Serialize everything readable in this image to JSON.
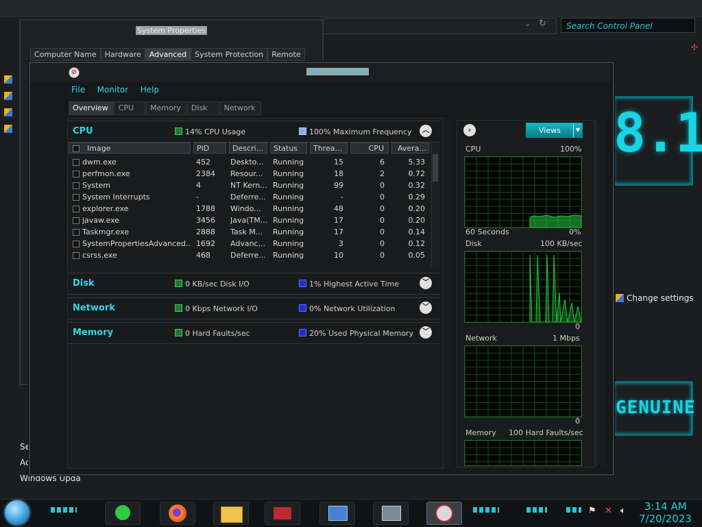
{
  "control_panel": {
    "search_placeholder": "Search Control Panel",
    "big_text": "8.1",
    "genuine_text": "GENUINE",
    "change_settings": "Change settings",
    "see_also": "See also",
    "action_center": "Action C",
    "windows_update": "Windows Upda"
  },
  "system_properties": {
    "title": "System Properties",
    "tabs": [
      "Computer Name",
      "Hardware",
      "Advanced",
      "System Protection",
      "Remote"
    ],
    "active_tab": "Advanced"
  },
  "resource_monitor": {
    "title": "Resource Monitor",
    "menu": [
      "File",
      "Monitor",
      "Help"
    ],
    "tabs": [
      "Overview",
      "CPU",
      "Memory",
      "Disk",
      "Network"
    ],
    "active_tab": "Overview",
    "sections": {
      "cpu": {
        "title": "CPU",
        "stat1": "14% CPU Usage",
        "stat2": "100% Maximum Frequency"
      },
      "disk": {
        "title": "Disk",
        "stat1": "0 KB/sec Disk I/O",
        "stat2": "1% Highest Active Time"
      },
      "network": {
        "title": "Network",
        "stat1": "0 Kbps Network I/O",
        "stat2": "0% Network Utilization"
      },
      "memory": {
        "title": "Memory",
        "stat1": "0 Hard Faults/sec",
        "stat2": "20% Used Physical Memory"
      }
    },
    "columns": [
      "Image",
      "PID",
      "Descri...",
      "Status",
      "Threa...",
      "CPU",
      "Avera..."
    ],
    "processes": [
      {
        "image": "dwm.exe",
        "pid": "452",
        "desc": "Deskto...",
        "status": "Running",
        "threads": "15",
        "cpu": "6",
        "avg": "5.33"
      },
      {
        "image": "perfmon.exe",
        "pid": "2384",
        "desc": "Resour...",
        "status": "Running",
        "threads": "18",
        "cpu": "2",
        "avg": "0.72"
      },
      {
        "image": "System",
        "pid": "4",
        "desc": "NT Kern...",
        "status": "Running",
        "threads": "99",
        "cpu": "0",
        "avg": "0.32"
      },
      {
        "image": "System Interrupts",
        "pid": "-",
        "desc": "Deferre...",
        "status": "Running",
        "threads": "-",
        "cpu": "0",
        "avg": "0.29"
      },
      {
        "image": "explorer.exe",
        "pid": "1788",
        "desc": "Windo...",
        "status": "Running",
        "threads": "48",
        "cpu": "0",
        "avg": "0.20"
      },
      {
        "image": "javaw.exe",
        "pid": "3456",
        "desc": "Java(TM...",
        "status": "Running",
        "threads": "17",
        "cpu": "0",
        "avg": "0.20"
      },
      {
        "image": "Taskmgr.exe",
        "pid": "2888",
        "desc": "Task M...",
        "status": "Running",
        "threads": "17",
        "cpu": "0",
        "avg": "0.14"
      },
      {
        "image": "SystemPropertiesAdvanced....",
        "pid": "1692",
        "desc": "Advanc...",
        "status": "Running",
        "threads": "3",
        "cpu": "0",
        "avg": "0.12"
      },
      {
        "image": "csrss.exe",
        "pid": "468",
        "desc": "Deferre...",
        "status": "Running",
        "threads": "10",
        "cpu": "0",
        "avg": "0.05"
      }
    ],
    "views_label": "Views",
    "graphs": {
      "cpu": {
        "label": "CPU",
        "max": "100%",
        "footer_left": "60 Seconds",
        "footer_right": "0%"
      },
      "disk": {
        "label": "Disk",
        "max": "100 KB/sec",
        "footer_right": "0"
      },
      "network": {
        "label": "Network",
        "max": "1 Mbps",
        "footer_right": "0"
      },
      "memory": {
        "label": "Memory",
        "max": "100 Hard Faults/sec"
      }
    }
  },
  "taskbar": {
    "time": "3:14 AM",
    "date": "7/20/2023"
  },
  "colors": {
    "accent": "#1ed0e2",
    "graph_line": "#22c93a"
  }
}
